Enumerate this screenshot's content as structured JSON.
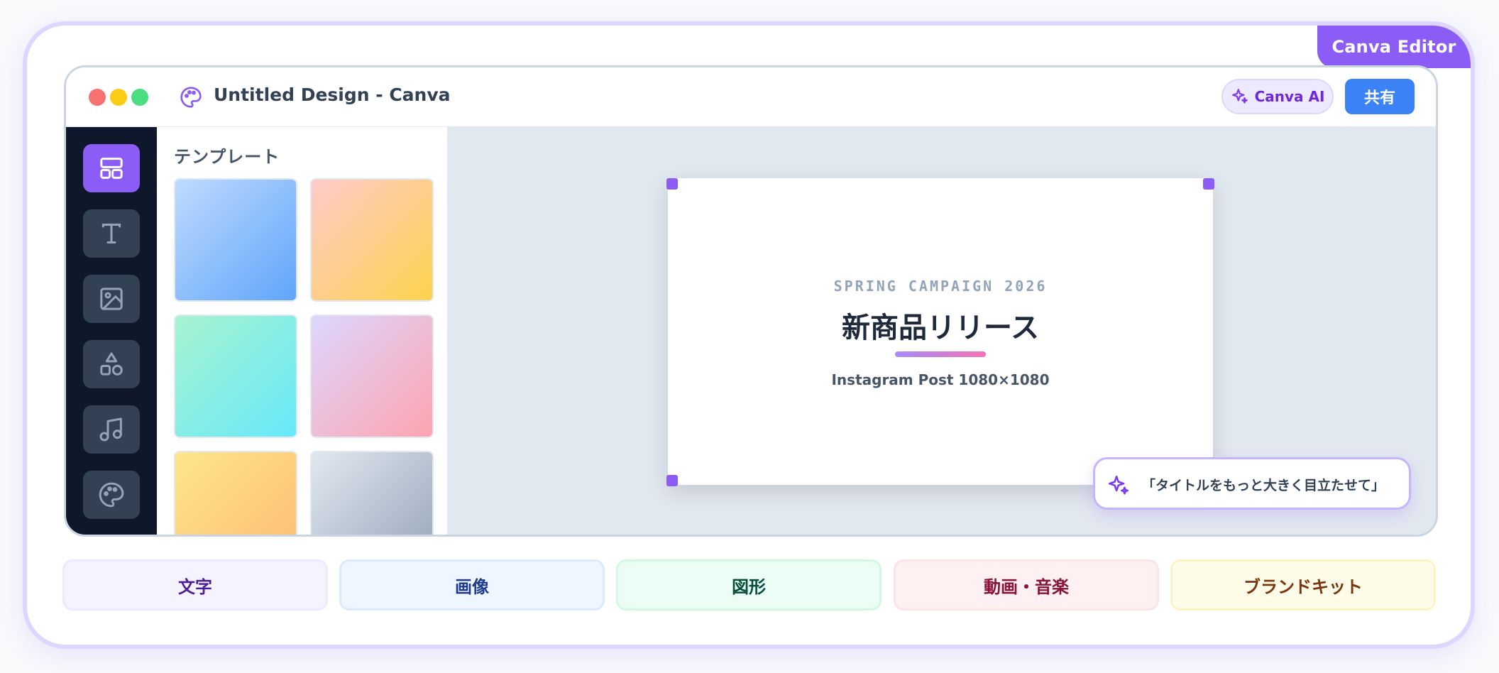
{
  "badge": "Canva Editor",
  "window": {
    "title": "Untitled Design - Canva",
    "ai_button": "Canva AI",
    "share_button": "共有"
  },
  "sidebar": {
    "tools": [
      {
        "icon": "layout-icon",
        "active": true
      },
      {
        "icon": "text-icon",
        "active": false
      },
      {
        "icon": "image-icon",
        "active": false
      },
      {
        "icon": "shapes-icon",
        "active": false
      },
      {
        "icon": "music-icon",
        "active": false
      },
      {
        "icon": "palette-icon",
        "active": false
      }
    ]
  },
  "panel": {
    "title": "テンプレート",
    "thumbnails": [
      {
        "from": "#bfdbfe",
        "to": "#60a5fa"
      },
      {
        "from": "#fecaca",
        "to": "#fcd34d"
      },
      {
        "from": "#a7f3d0",
        "to": "#67e8f9"
      },
      {
        "from": "#ddd6fe",
        "to": "#fda4af"
      },
      {
        "from": "#fde68a",
        "to": "#fdba74"
      },
      {
        "from": "#e2e8f0",
        "to": "#94a3b8"
      }
    ]
  },
  "artboard": {
    "eyebrow": "SPRING CAMPAIGN 2026",
    "headline": "新商品リリース",
    "subline": "Instagram Post 1080×1080"
  },
  "ai_prompt": "「タイトルをもっと大きく目立たせて」",
  "categories": [
    {
      "label": "文字",
      "bg": "#f5f3ff",
      "border": "#ede9fe",
      "color": "#4c1d95"
    },
    {
      "label": "画像",
      "bg": "#eff6ff",
      "border": "#dbeafe",
      "color": "#1e3a8a"
    },
    {
      "label": "図形",
      "bg": "#ecfdf5",
      "border": "#d1fae5",
      "color": "#064e3b"
    },
    {
      "label": "動画・音楽",
      "bg": "#fff1f2",
      "border": "#ffe4e6",
      "color": "#881337"
    },
    {
      "label": "ブランドキット",
      "bg": "#fefce8",
      "border": "#fef3c7",
      "color": "#78350f"
    }
  ],
  "colors": {
    "accent": "#8b5cf6",
    "share": "#3b82f6",
    "sidebar": "#0f172a"
  }
}
